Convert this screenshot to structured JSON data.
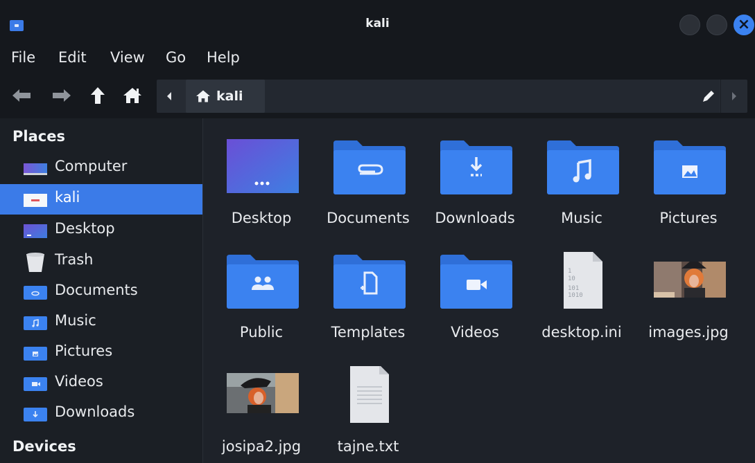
{
  "window": {
    "title": "kali"
  },
  "menu": [
    "File",
    "Edit",
    "View",
    "Go",
    "Help"
  ],
  "toolbar": {
    "path_crumb": "kali",
    "icons": [
      "back-arrow-icon",
      "forward-arrow-icon",
      "up-arrow-icon",
      "home-icon",
      "chevron-left-icon",
      "pencil-icon",
      "chevron-right-icon"
    ]
  },
  "sidebar": {
    "places_heading": "Places",
    "devices_heading": "Devices",
    "items": [
      {
        "label": "Computer",
        "icon": "computer-icon",
        "selected": false
      },
      {
        "label": "kali",
        "icon": "home-folder-icon",
        "selected": true
      },
      {
        "label": "Desktop",
        "icon": "desktop-icon",
        "selected": false
      },
      {
        "label": "Trash",
        "icon": "trash-icon",
        "selected": false
      },
      {
        "label": "Documents",
        "icon": "documents-folder-icon",
        "selected": false
      },
      {
        "label": "Music",
        "icon": "music-folder-icon",
        "selected": false
      },
      {
        "label": "Pictures",
        "icon": "pictures-folder-icon",
        "selected": false
      },
      {
        "label": "Videos",
        "icon": "videos-folder-icon",
        "selected": false
      },
      {
        "label": "Downloads",
        "icon": "downloads-folder-icon",
        "selected": false
      }
    ]
  },
  "files": [
    {
      "name": "Desktop",
      "type": "desktop"
    },
    {
      "name": "Documents",
      "type": "folder",
      "emblem": "paperclip"
    },
    {
      "name": "Downloads",
      "type": "folder",
      "emblem": "download"
    },
    {
      "name": "Music",
      "type": "folder",
      "emblem": "music"
    },
    {
      "name": "Pictures",
      "type": "folder",
      "emblem": "image"
    },
    {
      "name": "Public",
      "type": "folder",
      "emblem": "people"
    },
    {
      "name": "Templates",
      "type": "folder",
      "emblem": "template"
    },
    {
      "name": "Videos",
      "type": "folder",
      "emblem": "video"
    },
    {
      "name": "desktop.ini",
      "type": "binary"
    },
    {
      "name": "images.jpg",
      "type": "image"
    },
    {
      "name": "josipa2.jpg",
      "type": "image"
    },
    {
      "name": "tajne.txt",
      "type": "text"
    }
  ],
  "colors": {
    "accent": "#3b7be8",
    "folder": "#3b82f0",
    "window_bg": "#1e2229",
    "chrome_bg": "#15181d"
  }
}
